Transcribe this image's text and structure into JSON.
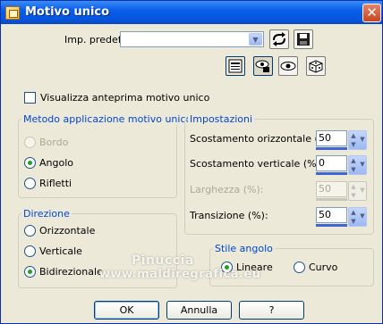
{
  "window": {
    "title": "Motivo unico",
    "close_symbol": "✕",
    "icon": "app-icon"
  },
  "preset": {
    "label": "Imp. predef.:",
    "value": "",
    "dropdown_symbol": "▼"
  },
  "toolbar_icons": [
    "reset-icon",
    "save-icon",
    "list-icon",
    "eye-lock-icon",
    "eye-icon",
    "dice-icon"
  ],
  "preview": {
    "label": "Visualizza anteprima motivo unico",
    "checked": false
  },
  "metodo": {
    "title": "Metodo applicazione motivo unico",
    "options": [
      "Bordo",
      "Angolo",
      "Rifletti"
    ],
    "selected": "Angolo"
  },
  "direzione": {
    "title": "Direzione",
    "options": [
      "Orizzontale",
      "Verticale",
      "Bidirezionale"
    ],
    "selected": "Bidirezionale"
  },
  "impostazioni": {
    "title": "Impostazioni",
    "fields": [
      {
        "label": "Scostamento orizzontale (%):",
        "value": "50",
        "enabled": true
      },
      {
        "label": "Scostamento verticale (%):",
        "value": "0",
        "enabled": true
      },
      {
        "label": "Larghezza (%):",
        "value": "50",
        "enabled": false
      },
      {
        "label": "Transizione (%):",
        "value": "50",
        "enabled": true
      }
    ]
  },
  "stile": {
    "title": "Stile angolo",
    "options": [
      "Lineare",
      "Curvo"
    ],
    "selected": "Lineare"
  },
  "buttons": {
    "ok": "OK",
    "cancel": "Annulla",
    "help": "?"
  },
  "watermark": {
    "line1": "Pinuccia",
    "line2": "www.maldiregrafica.eu"
  }
}
